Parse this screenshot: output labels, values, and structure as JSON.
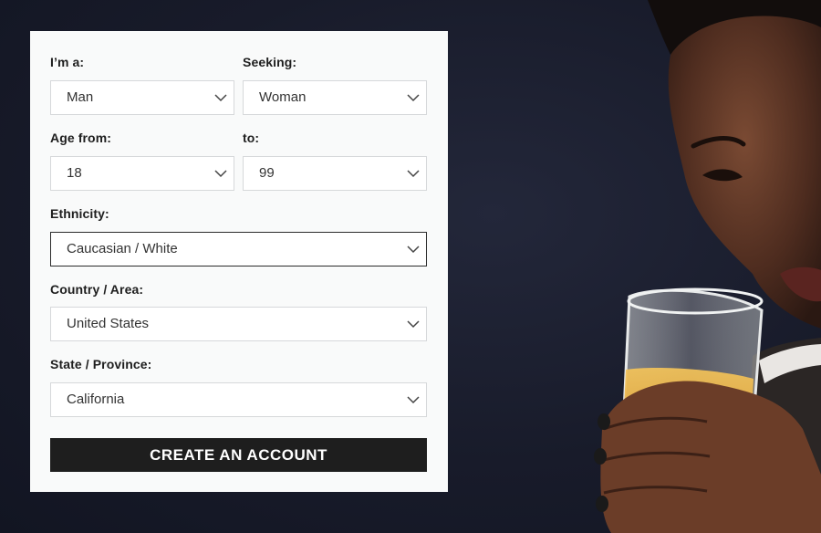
{
  "form": {
    "gender": {
      "label": "I’m a:",
      "value": "Man"
    },
    "seeking": {
      "label": "Seeking:",
      "value": "Woman"
    },
    "age_from": {
      "label": "Age from:",
      "value": "18"
    },
    "age_to": {
      "label": "to:",
      "value": "99"
    },
    "ethnicity": {
      "label": "Ethnicity:",
      "value": "Caucasian / White"
    },
    "country": {
      "label": "Country / Area:",
      "value": "United States"
    },
    "state": {
      "label": "State / Province:",
      "value": "California"
    },
    "submit_label": "CREATE AN ACCOUNT"
  },
  "colors": {
    "background": "#181b2a",
    "card": "#f9fafa",
    "button": "#1e1e1e",
    "button_text": "#ffffff"
  }
}
